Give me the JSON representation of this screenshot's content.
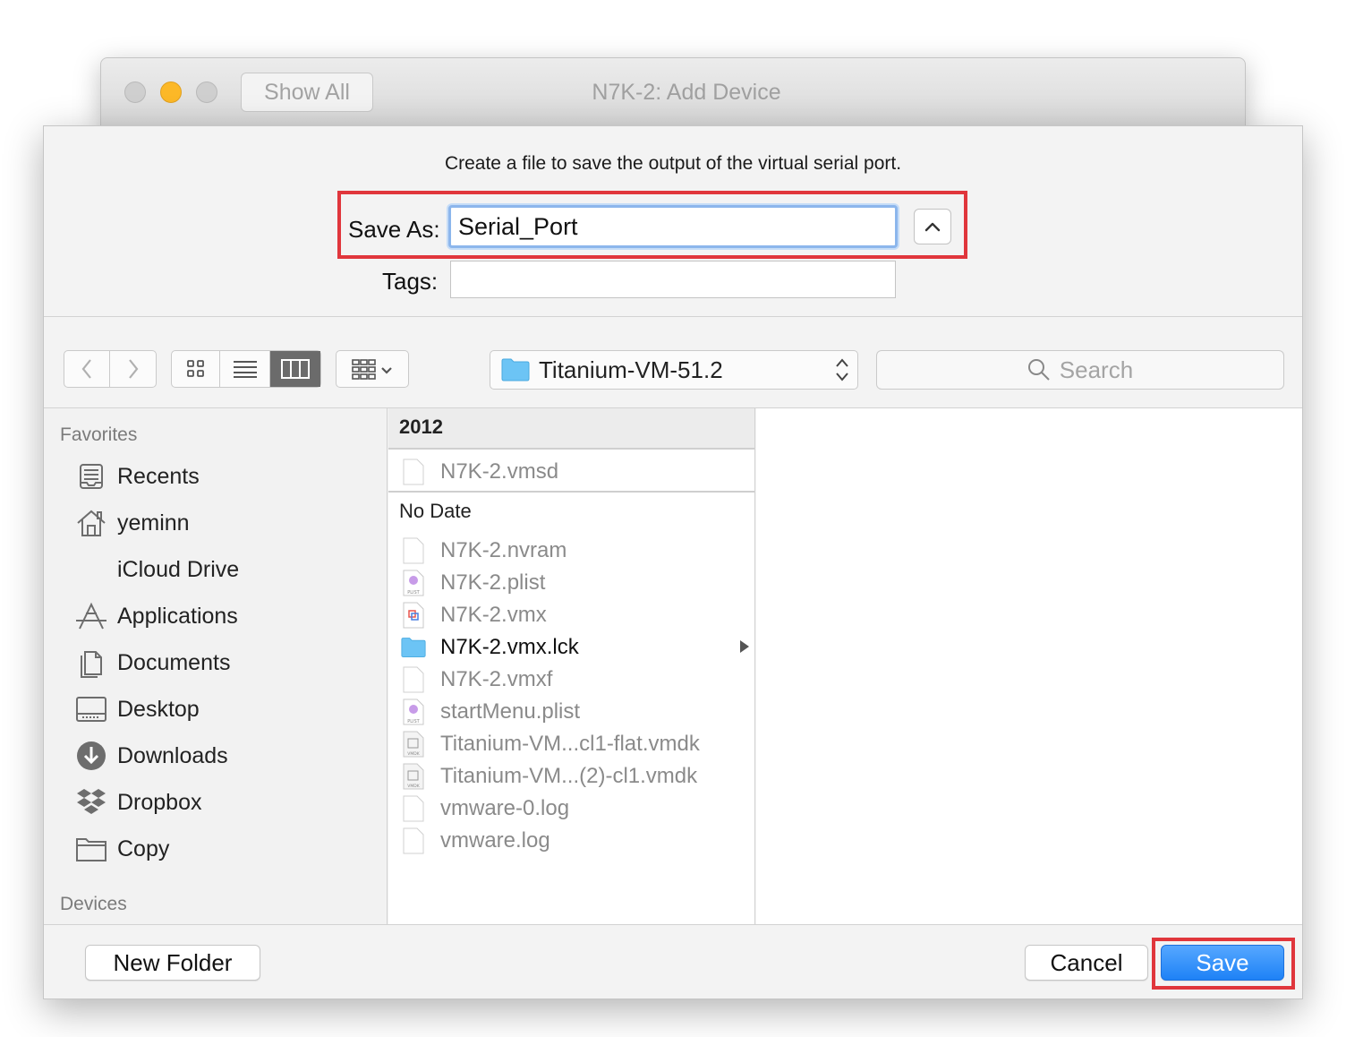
{
  "background_window": {
    "title": "N7K-2: Add Device",
    "show_all_label": "Show All"
  },
  "dialog": {
    "prompt": "Create a file to save the output of the virtual serial port.",
    "save_as_label": "Save As:",
    "save_as_value": "Serial_Port",
    "tags_label": "Tags:",
    "tags_value": ""
  },
  "toolbar": {
    "path_label": "Titanium-VM-51.2",
    "search_placeholder": "Search"
  },
  "sidebar": {
    "favorites_header": "Favorites",
    "devices_header": "Devices",
    "items": [
      {
        "label": "Recents",
        "icon": "recents-icon"
      },
      {
        "label": "yeminn",
        "icon": "home-icon"
      },
      {
        "label": "iCloud Drive",
        "icon": ""
      },
      {
        "label": "Applications",
        "icon": "applications-icon"
      },
      {
        "label": "Documents",
        "icon": "documents-icon"
      },
      {
        "label": "Desktop",
        "icon": "desktop-icon"
      },
      {
        "label": "Downloads",
        "icon": "downloads-icon"
      },
      {
        "label": "Dropbox",
        "icon": "dropbox-icon"
      },
      {
        "label": "Copy",
        "icon": "folder-icon"
      }
    ]
  },
  "files": {
    "group_2012": "2012",
    "group_2012_files": [
      "N7K-2.vmsd"
    ],
    "group_nodate": "No Date",
    "group_nodate_files": [
      {
        "name": "N7K-2.nvram",
        "type": "blank"
      },
      {
        "name": "N7K-2.plist",
        "type": "plist"
      },
      {
        "name": "N7K-2.vmx",
        "type": "vmx"
      },
      {
        "name": "N7K-2.vmx.lck",
        "type": "folder"
      },
      {
        "name": "N7K-2.vmxf",
        "type": "blank"
      },
      {
        "name": "startMenu.plist",
        "type": "plist"
      },
      {
        "name": "Titanium-VM...cl1-flat.vmdk",
        "type": "vmdk"
      },
      {
        "name": "Titanium-VM...(2)-cl1.vmdk",
        "type": "vmdk"
      },
      {
        "name": "vmware-0.log",
        "type": "blank"
      },
      {
        "name": "vmware.log",
        "type": "blank"
      }
    ]
  },
  "footer": {
    "new_folder_label": "New Folder",
    "cancel_label": "Cancel",
    "save_label": "Save"
  },
  "colors": {
    "accent": "#1e82f6",
    "highlight": "#e0363c",
    "folder": "#6cc4f5"
  }
}
